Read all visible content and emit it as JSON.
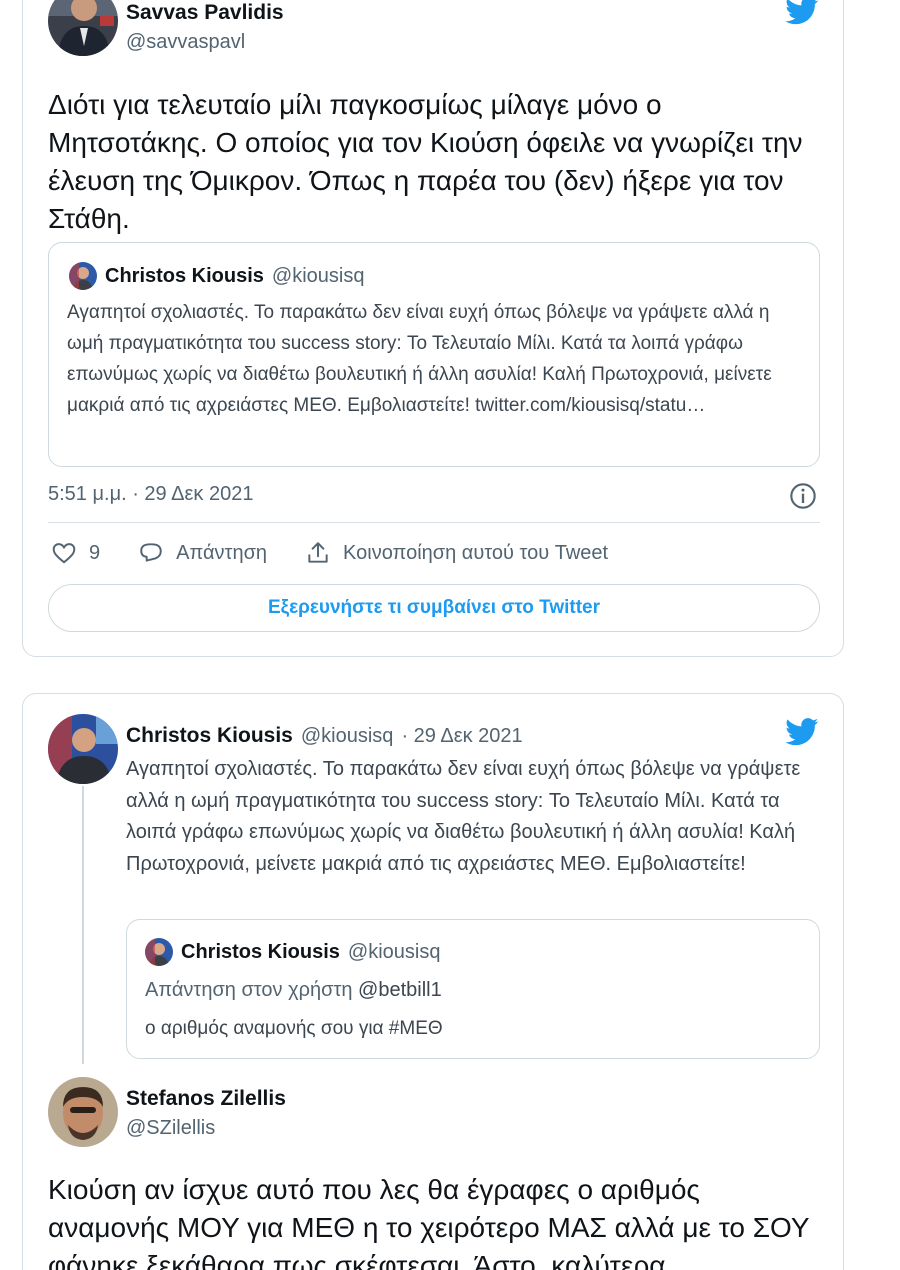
{
  "tweet1": {
    "author": {
      "name": "Savvas Pavlidis",
      "handle": "@savvaspavl"
    },
    "text": "Διότι για τελευταίο μίλι παγκοσμίως μίλαγε μόνο ο Μητσοτάκης. Ο οποίος για τον Κιούση όφειλε να γνωρίζει την έλευση της Όμικρον. Όπως η παρέα του (δεν) ήξερε για τον Στάθη.",
    "quoted": {
      "name": "Christos Kiousis",
      "handle": "@kiousisq",
      "text": "Αγαπητοί σχολιαστές. Το παρακάτω δεν είναι ευχή όπως βόλεψε να γράψετε αλλά η ωμή πραγματικότητα του success story: Το Τελευταίο Μίλι. Κατά τα λοιπά γράφω επωνύμως χωρίς να διαθέτω βουλευτική ή άλλη ασυλία! Καλή Πρωτοχρονιά, μείνετε μακριά από τις αχρειάστες ΜΕΘ. Εμβολιαστείτε! twitter.com/kiousisq/statu…"
    },
    "timestamp": "5:51 μ.μ. · 29 Δεκ 2021",
    "likes": "9",
    "reply_label": "Απάντηση",
    "share_label": "Κοινοποίηση αυτού του Tweet",
    "explore_label": "Εξερευνήστε τι συμβαίνει στο Twitter"
  },
  "tweet2": {
    "author": {
      "name": "Christos Kiousis",
      "handle": "@kiousisq",
      "date": "· 29 Δεκ 2021"
    },
    "text": "Αγαπητοί σχολιαστές. Το παρακάτω δεν είναι ευχή όπως βόλεψε να γράψετε αλλά η ωμή πραγματικότητα του success story: Το Τελευταίο Μίλι. Κατά τα λοιπά γράφω επωνύμως χωρίς να διαθέτω βουλευτική ή άλλη ασυλία! Καλή Πρωτοχρονιά, μείνετε μακριά από τις αχρειάστες ΜΕΘ. Εμβολιαστείτε!",
    "quoted": {
      "name": "Christos Kiousis",
      "handle": "@kiousisq",
      "reply_prefix": "Απάντηση στον χρήστη",
      "reply_mention": "@betbill1",
      "text": "ο αριθμός αναμονής σου για #ΜΕΘ"
    }
  },
  "tweet3": {
    "author": {
      "name": "Stefanos Zilellis",
      "handle": "@SZilellis"
    },
    "text": "Κιούση αν ίσχυε αυτό που λες θα έγραφες ο αριθμός αναμονής ΜΟΥ για ΜΕΘ η το χειρότερο ΜΑΣ αλλά με το ΣΟΥ φάνηκε ξεκάθαρα πως σκέφτεσαι. Άστο, καλύτερα"
  },
  "colors": {
    "twitter_blue": "#1d9bf0",
    "secondary_text": "#536471",
    "border": "#cfd9de"
  },
  "icons": [
    "twitter-bird-icon",
    "info-icon",
    "heart-icon",
    "reply-icon",
    "share-icon"
  ]
}
